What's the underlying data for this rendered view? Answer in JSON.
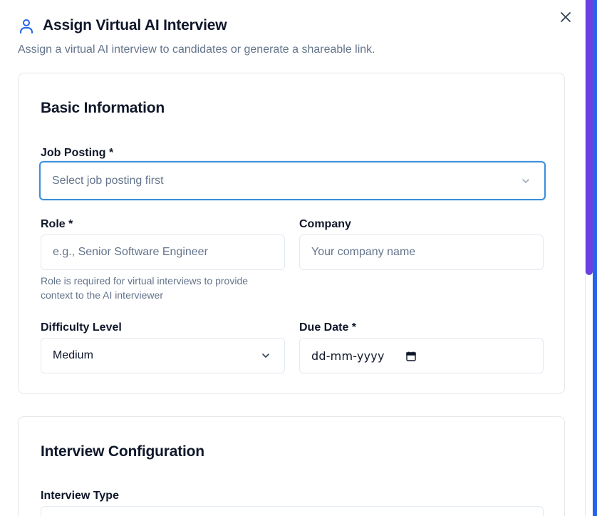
{
  "dialog": {
    "title": "Assign Virtual AI Interview",
    "subtitle": "Assign a virtual AI interview to candidates or generate a shareable link.",
    "icons": {
      "header": "user-icon",
      "close": "close-icon"
    }
  },
  "basic_info": {
    "title": "Basic Information",
    "job_posting": {
      "label": "Job Posting *",
      "placeholder": "Select job posting first"
    },
    "role": {
      "label": "Role *",
      "placeholder": "e.g., Senior Software Engineer",
      "help": "Role is required for virtual interviews to provide context to the AI interviewer"
    },
    "company": {
      "label": "Company",
      "placeholder": "Your company name"
    },
    "difficulty": {
      "label": "Difficulty Level",
      "value": "Medium"
    },
    "due_date": {
      "label": "Due Date *",
      "value": "dd-mm-yyyy"
    }
  },
  "interview_config": {
    "title": "Interview Configuration",
    "interview_type": {
      "label": "Interview Type"
    }
  },
  "colors": {
    "focus_ring": "#3b8fd9",
    "accent_icon": "#2563eb",
    "scrollbar": "#6c3fe0"
  }
}
